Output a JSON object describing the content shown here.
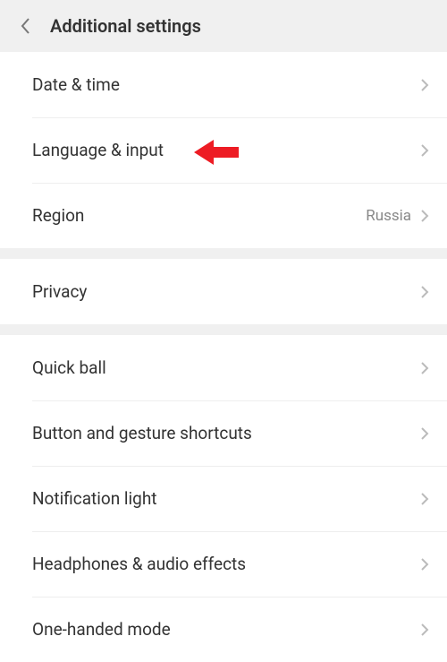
{
  "header": {
    "title": "Additional settings"
  },
  "groups": [
    {
      "rows": [
        {
          "label": "Date & time",
          "value": ""
        },
        {
          "label": "Language & input",
          "value": ""
        },
        {
          "label": "Region",
          "value": "Russia"
        }
      ]
    },
    {
      "rows": [
        {
          "label": "Privacy",
          "value": ""
        }
      ]
    },
    {
      "rows": [
        {
          "label": "Quick ball",
          "value": ""
        },
        {
          "label": "Button and gesture shortcuts",
          "value": ""
        },
        {
          "label": "Notification light",
          "value": ""
        },
        {
          "label": "Headphones & audio effects",
          "value": ""
        },
        {
          "label": "One-handed mode",
          "value": ""
        }
      ]
    }
  ],
  "annotation": {
    "type": "arrow-left",
    "color": "#ed1c24",
    "target": "language-input"
  }
}
